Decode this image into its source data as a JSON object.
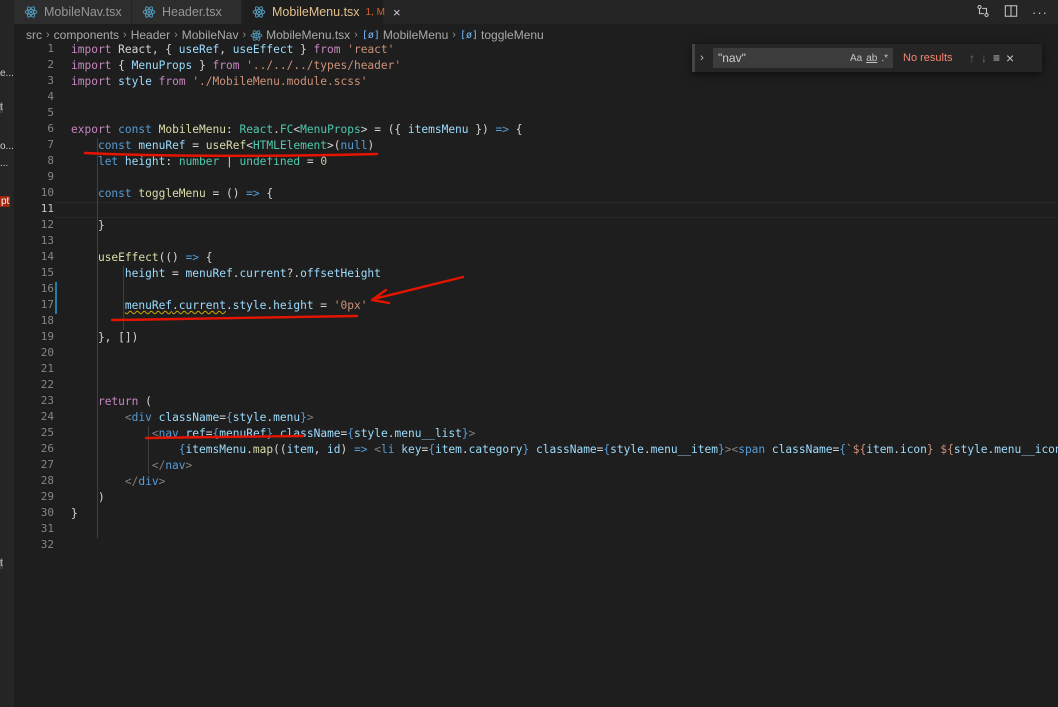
{
  "tabs": [
    {
      "label": "MobileNav.tsx",
      "active": false
    },
    {
      "label": "Header.tsx",
      "active": false
    },
    {
      "label": "MobileMenu.tsx",
      "active": true,
      "badge": "1, M",
      "close": "×"
    }
  ],
  "breadcrumb": [
    "src",
    "components",
    "Header",
    "MobileNav",
    "MobileMenu.tsx",
    "MobileMenu",
    "toggleMenu"
  ],
  "breadcrumb_symbol": "[ø]",
  "left_strip": [
    "e...",
    "t",
    "o...",
    "...",
    "pt",
    "t"
  ],
  "find": {
    "value": "\"nav\"",
    "match_case": "Aa",
    "whole_word": "ab",
    "regex": ".*",
    "status": "No results",
    "prev": "↑",
    "next": "↓",
    "selection": "≡",
    "close": "×"
  },
  "line_numbers": [
    "1",
    "2",
    "3",
    "4",
    "5",
    "6",
    "7",
    "8",
    "9",
    "10",
    "11",
    "12",
    "13",
    "14",
    "15",
    "16",
    "17",
    "18",
    "19",
    "20",
    "21",
    "22",
    "23",
    "24",
    "25",
    "26",
    "27",
    "28",
    "29",
    "30",
    "31",
    "32"
  ],
  "current_line": 11,
  "colors": {
    "keyword": "#569cd6",
    "control": "#c586c0",
    "variable": "#9cdcfe",
    "function": "#dcdcaa",
    "type": "#4ec9b0",
    "string": "#ce9178",
    "number": "#b5cea8",
    "annotation": "#e51400"
  },
  "code": {
    "l1": [
      [
        "c",
        "import"
      ],
      [
        "p",
        " React, { "
      ],
      [
        "v",
        "useRef"
      ],
      [
        "p",
        ", "
      ],
      [
        "v",
        "useEffect"
      ],
      [
        "p",
        " } "
      ],
      [
        "c",
        "from"
      ],
      [
        "p",
        " "
      ],
      [
        "s",
        "'react'"
      ]
    ],
    "l2": [
      [
        "c",
        "import"
      ],
      [
        "p",
        " { "
      ],
      [
        "v",
        "MenuProps"
      ],
      [
        "p",
        " } "
      ],
      [
        "c",
        "from"
      ],
      [
        "p",
        " "
      ],
      [
        "s",
        "'../../../types/header'"
      ]
    ],
    "l3": [
      [
        "c",
        "import"
      ],
      [
        "p",
        " "
      ],
      [
        "v",
        "style"
      ],
      [
        "p",
        " "
      ],
      [
        "c",
        "from"
      ],
      [
        "p",
        " "
      ],
      [
        "s",
        "'./MobileMenu.module.scss'"
      ]
    ],
    "l6": [
      [
        "c",
        "export"
      ],
      [
        "p",
        " "
      ],
      [
        "k",
        "const"
      ],
      [
        "p",
        " "
      ],
      [
        "f",
        "MobileMenu"
      ],
      [
        "p",
        ": "
      ],
      [
        "t",
        "React"
      ],
      [
        "p",
        "."
      ],
      [
        "t",
        "FC"
      ],
      [
        "p",
        "<"
      ],
      [
        "t",
        "MenuProps"
      ],
      [
        "p",
        "> = ({ "
      ],
      [
        "v",
        "itemsMenu"
      ],
      [
        "p",
        " }) "
      ],
      [
        "k",
        "=>"
      ],
      [
        "p",
        " {"
      ]
    ],
    "l7": [
      [
        "p",
        "    "
      ],
      [
        "k",
        "const"
      ],
      [
        "p",
        " "
      ],
      [
        "v",
        "menuRef"
      ],
      [
        "p",
        " = "
      ],
      [
        "f",
        "useRef"
      ],
      [
        "p",
        "<"
      ],
      [
        "t",
        "HTMLElement"
      ],
      [
        "p",
        ">("
      ],
      [
        "k",
        "null"
      ],
      [
        "p",
        ")"
      ]
    ],
    "l8": [
      [
        "p",
        "    "
      ],
      [
        "k",
        "let"
      ],
      [
        "p",
        " "
      ],
      [
        "v",
        "height"
      ],
      [
        "p",
        ": "
      ],
      [
        "t",
        "number"
      ],
      [
        "p",
        " | "
      ],
      [
        "t",
        "undefined"
      ],
      [
        "p",
        " = "
      ],
      [
        "n",
        "0"
      ]
    ],
    "l10": [
      [
        "p",
        "    "
      ],
      [
        "k",
        "const"
      ],
      [
        "p",
        " "
      ],
      [
        "f",
        "toggleMenu"
      ],
      [
        "p",
        " = () "
      ],
      [
        "k",
        "=>"
      ],
      [
        "p",
        " {"
      ]
    ],
    "l12": [
      [
        "p",
        "    }"
      ]
    ],
    "l14": [
      [
        "p",
        "    "
      ],
      [
        "f",
        "useEffect"
      ],
      [
        "p",
        "(() "
      ],
      [
        "k",
        "=>"
      ],
      [
        "p",
        " {"
      ]
    ],
    "l15": [
      [
        "p",
        "        "
      ],
      [
        "v",
        "height"
      ],
      [
        "p",
        " = "
      ],
      [
        "v",
        "menuRef"
      ],
      [
        "p",
        "."
      ],
      [
        "v",
        "current"
      ],
      [
        "p",
        "?."
      ],
      [
        "v",
        "offsetHeight"
      ]
    ],
    "l17": [
      [
        "p",
        "        "
      ],
      [
        "vq",
        "menuRef"
      ],
      [
        "pq",
        "."
      ],
      [
        "vq",
        "current"
      ],
      [
        "p",
        "."
      ],
      [
        "v",
        "style"
      ],
      [
        "p",
        "."
      ],
      [
        "v",
        "height"
      ],
      [
        "p",
        " = "
      ],
      [
        "s",
        "'0px'"
      ]
    ],
    "l19": [
      [
        "p",
        "    }, [])"
      ]
    ],
    "l23": [
      [
        "p",
        "    "
      ],
      [
        "c",
        "return"
      ],
      [
        "p",
        " ("
      ]
    ],
    "l24": [
      [
        "p",
        "        "
      ],
      [
        "gray",
        "<"
      ],
      [
        "tag",
        "div"
      ],
      [
        "p",
        " "
      ],
      [
        "v",
        "className"
      ],
      [
        "p",
        "="
      ],
      [
        "k",
        "{"
      ],
      [
        "v",
        "style"
      ],
      [
        "p",
        "."
      ],
      [
        "v",
        "menu"
      ],
      [
        "k",
        "}"
      ],
      [
        "gray",
        ">"
      ]
    ],
    "l25": [
      [
        "p",
        "            "
      ],
      [
        "gray",
        "<"
      ],
      [
        "tag",
        "nav"
      ],
      [
        "p",
        " "
      ],
      [
        "v",
        "ref"
      ],
      [
        "p",
        "="
      ],
      [
        "k",
        "{"
      ],
      [
        "v",
        "menuRef"
      ],
      [
        "k",
        "}"
      ],
      [
        "p",
        " "
      ],
      [
        "v",
        "className"
      ],
      [
        "p",
        "="
      ],
      [
        "k",
        "{"
      ],
      [
        "v",
        "style"
      ],
      [
        "p",
        "."
      ],
      [
        "v",
        "menu__list"
      ],
      [
        "k",
        "}"
      ],
      [
        "gray",
        ">"
      ]
    ],
    "l26": [
      [
        "p",
        "                "
      ],
      [
        "k",
        "{"
      ],
      [
        "v",
        "itemsMenu"
      ],
      [
        "p",
        "."
      ],
      [
        "f",
        "map"
      ],
      [
        "p",
        "(("
      ],
      [
        "v",
        "item"
      ],
      [
        "p",
        ", "
      ],
      [
        "v",
        "id"
      ],
      [
        "p",
        ") "
      ],
      [
        "k",
        "=>"
      ],
      [
        "p",
        " "
      ],
      [
        "gray",
        "<"
      ],
      [
        "tag",
        "li"
      ],
      [
        "p",
        " "
      ],
      [
        "v",
        "key"
      ],
      [
        "p",
        "="
      ],
      [
        "k",
        "{"
      ],
      [
        "v",
        "item"
      ],
      [
        "p",
        "."
      ],
      [
        "v",
        "category"
      ],
      [
        "k",
        "}"
      ],
      [
        "p",
        " "
      ],
      [
        "v",
        "className"
      ],
      [
        "p",
        "="
      ],
      [
        "k",
        "{"
      ],
      [
        "v",
        "style"
      ],
      [
        "p",
        "."
      ],
      [
        "v",
        "menu__item"
      ],
      [
        "k",
        "}"
      ],
      [
        "gray",
        "><"
      ],
      [
        "tag",
        "span"
      ],
      [
        "p",
        " "
      ],
      [
        "v",
        "className"
      ],
      [
        "p",
        "="
      ],
      [
        "k",
        "{"
      ],
      [
        "s",
        "`${"
      ],
      [
        "v",
        "item"
      ],
      [
        "p",
        "."
      ],
      [
        "v",
        "icon"
      ],
      [
        "s",
        "} ${"
      ],
      [
        "v",
        "style"
      ],
      [
        "p",
        "."
      ],
      [
        "v",
        "menu__icon"
      ],
      [
        "s",
        "}`"
      ],
      [
        "k",
        "}"
      ],
      [
        "gray",
        "></"
      ]
    ],
    "l27": [
      [
        "p",
        "            "
      ],
      [
        "gray",
        "</"
      ],
      [
        "tag",
        "nav"
      ],
      [
        "gray",
        ">"
      ]
    ],
    "l28": [
      [
        "p",
        "        "
      ],
      [
        "gray",
        "</"
      ],
      [
        "tag",
        "div"
      ],
      [
        "gray",
        ">"
      ]
    ],
    "l29": [
      [
        "p",
        "    )"
      ]
    ],
    "l30": [
      [
        "p",
        "}"
      ]
    ]
  }
}
